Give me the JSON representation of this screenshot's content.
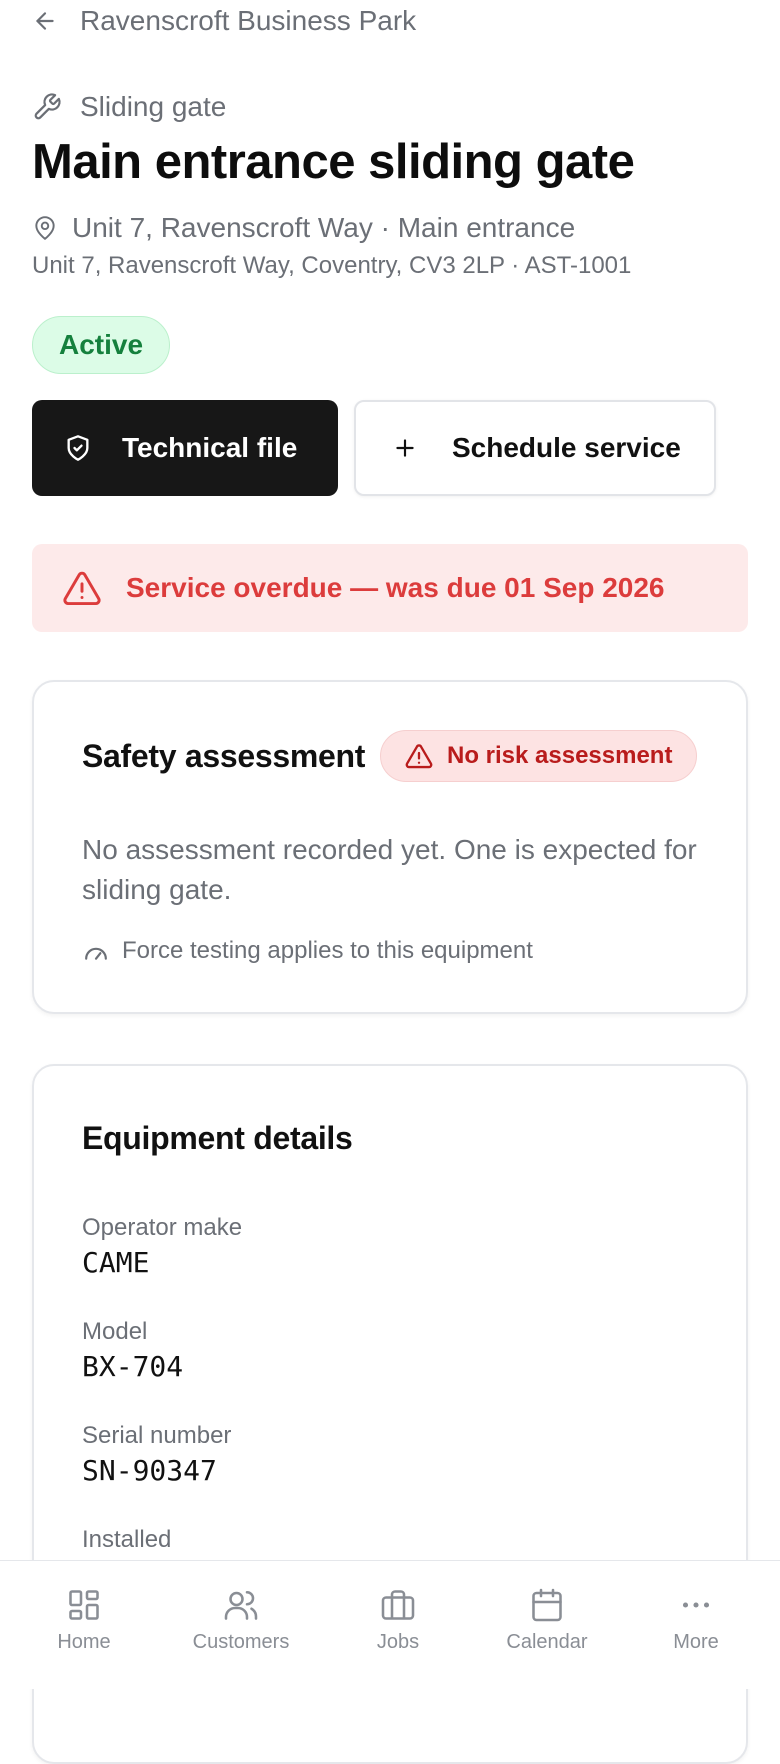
{
  "header": {
    "back_label": "Ravenscroft Business Park"
  },
  "asset": {
    "type": "Sliding gate",
    "title": "Main entrance sliding gate",
    "location": "Unit 7, Ravenscroft Way · Main entrance",
    "address": "Unit 7, Ravenscroft Way, Coventry, CV3 2LP · AST-1001",
    "status": "Active"
  },
  "actions": {
    "technical_file": "Technical file",
    "schedule_service": "Schedule service"
  },
  "alert": {
    "message": "Service overdue — was due 01 Sep 2026"
  },
  "safety": {
    "title": "Safety assessment",
    "badge": "No risk assessment",
    "description": "No assessment recorded yet. One is expected for sliding gate.",
    "force_note": "Force testing applies to this equipment"
  },
  "equipment": {
    "title": "Equipment details",
    "fields": [
      {
        "label": "Operator make",
        "value": "CAME"
      },
      {
        "label": "Model",
        "value": "BX-704"
      },
      {
        "label": "Serial number",
        "value": "SN-90347"
      },
      {
        "label": "Installed",
        "value": ""
      }
    ]
  },
  "nav": {
    "items": [
      {
        "label": "Home",
        "icon": "home-grid-icon"
      },
      {
        "label": "Customers",
        "icon": "users-icon"
      },
      {
        "label": "Jobs",
        "icon": "briefcase-icon"
      },
      {
        "label": "Calendar",
        "icon": "calendar-icon"
      },
      {
        "label": "More",
        "icon": "more-dots-icon"
      }
    ]
  },
  "colors": {
    "status_green": "#15803d",
    "alert_red": "#dc3c3c",
    "primary_dark": "#171717"
  }
}
